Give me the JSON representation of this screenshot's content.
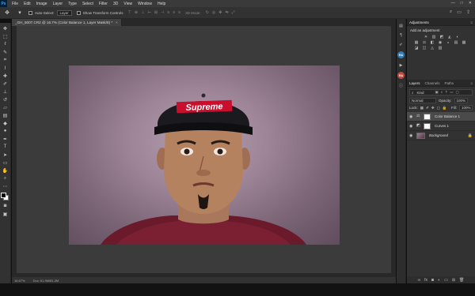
{
  "menubar": {
    "logo": "Ps",
    "items": [
      "File",
      "Edit",
      "Image",
      "Layer",
      "Type",
      "Select",
      "Filter",
      "3D",
      "View",
      "Window",
      "Help"
    ],
    "controls": [
      "—",
      "□",
      "✕"
    ]
  },
  "options": {
    "auto_select_label": "Auto-Select:",
    "auto_select_value": "Layer",
    "show_transform_label": "Show Transform Controls",
    "mode_3d_label": "3D Mode:"
  },
  "document": {
    "tab_title": "_GH_5007.CR2 @ 16.7% (Color Balance 1, Layer Mask/8) *",
    "close": "×",
    "zoom": "16.67%",
    "doc_size": "Doc: 61.9M/81.2M"
  },
  "adjustments": {
    "tab_label": "Adjustments",
    "title": "Add an adjustment",
    "icon_rows": [
      [
        "☀",
        "▥",
        "◩",
        "◭",
        "◐"
      ],
      [
        "▦",
        "⚖",
        "◧",
        "◉",
        "◒",
        "▤",
        "▦"
      ],
      [
        "◪",
        "◫",
        "◬",
        "▧"
      ]
    ]
  },
  "layers": {
    "tabs": [
      "Layers",
      "Channels",
      "Paths"
    ],
    "filter_label": "Kind",
    "blend_mode": "Normal",
    "opacity_label": "Opacity:",
    "opacity_value": "100%",
    "lock_label": "Lock:",
    "fill_label": "Fill:",
    "fill_value": "100%",
    "items": [
      {
        "name": "Color Balance 1",
        "selected": true,
        "kind": "adjustment"
      },
      {
        "name": "Curves 1",
        "selected": false,
        "kind": "adjustment"
      },
      {
        "name": "Background",
        "selected": false,
        "kind": "image"
      }
    ]
  },
  "photo": {
    "cap_text": "Supreme"
  },
  "colors": {
    "accent": "#31a8ff",
    "canvas_bg": "#3b3b3b",
    "panel_bg": "#323232"
  }
}
